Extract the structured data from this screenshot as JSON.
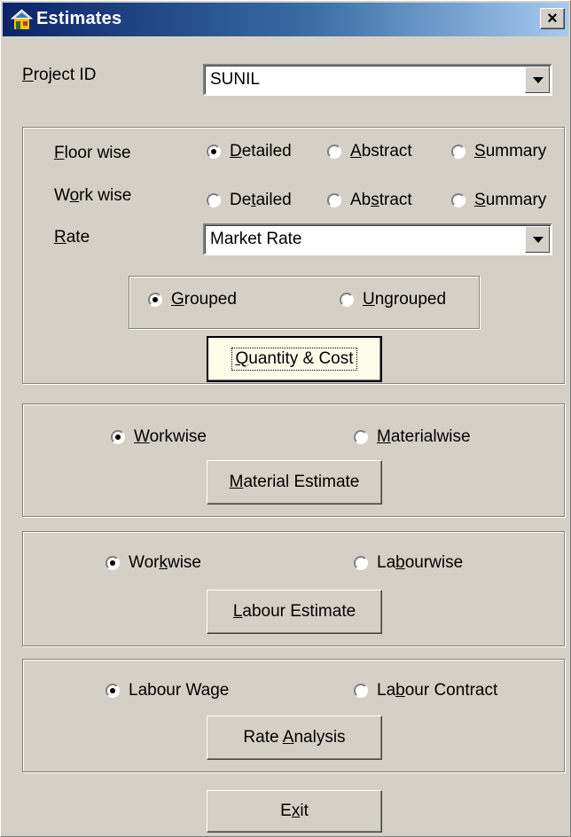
{
  "window": {
    "title": "Estimates",
    "close_label": "×"
  },
  "project": {
    "label_pre": "",
    "label_key": "P",
    "label_post": "roject ID",
    "value": "SUNIL"
  },
  "quantity_section": {
    "floor_wise": {
      "pre": "",
      "key": "F",
      "post": "loor wise"
    },
    "work_wise": {
      "pre": "W",
      "key": "o",
      "post": "rk wise"
    },
    "rate": {
      "pre": "",
      "key": "R",
      "post": "ate"
    },
    "rate_value": "Market Rate",
    "floor_options": [
      {
        "pre": "",
        "key": "D",
        "post": "etailed",
        "selected": true
      },
      {
        "pre": "",
        "key": "A",
        "post": "bstract",
        "selected": false
      },
      {
        "pre": "",
        "key": "S",
        "post": "ummary",
        "selected": false
      }
    ],
    "work_options": [
      {
        "pre": "De",
        "key": "t",
        "post": "ailed",
        "selected": false
      },
      {
        "pre": "Ab",
        "key": "s",
        "post": "tract",
        "selected": false
      },
      {
        "pre": "",
        "key": "S",
        "post": "ummary",
        "selected": false
      }
    ],
    "group_options": [
      {
        "pre": "",
        "key": "G",
        "post": "rouped",
        "selected": true
      },
      {
        "pre": "",
        "key": "U",
        "post": "ngrouped",
        "selected": false
      }
    ],
    "button": {
      "pre": "",
      "key": "Q",
      "post": "uantity & Cost"
    }
  },
  "material_section": {
    "options": [
      {
        "pre": "",
        "key": "W",
        "post": "orkwise",
        "selected": true
      },
      {
        "pre": "",
        "key": "M",
        "post": "aterialwise",
        "selected": false
      }
    ],
    "button": {
      "pre": "",
      "key": "M",
      "post": "aterial Estimate"
    }
  },
  "labour_section": {
    "options": [
      {
        "pre": "Wor",
        "key": "k",
        "post": "wise",
        "selected": true
      },
      {
        "pre": "La",
        "key": "b",
        "post": "ourwise",
        "selected": false
      }
    ],
    "button": {
      "pre": "",
      "key": "L",
      "post": "abour Estimate"
    }
  },
  "rate_section": {
    "options": [
      {
        "pre": "Labour Wage",
        "key": "",
        "post": "",
        "selected": true
      },
      {
        "pre": "La",
        "key": "b",
        "post": "our Contract",
        "selected": false
      }
    ],
    "button": {
      "pre": "Rate ",
      "key": "A",
      "post": "nalysis"
    }
  },
  "exit_button": {
    "pre": "E",
    "key": "x",
    "post": "it"
  },
  "colors": {
    "title_start": "#0a246a",
    "title_end": "#a6caf0",
    "face": "#d4d0c8",
    "default_button": "#fdfce8"
  }
}
